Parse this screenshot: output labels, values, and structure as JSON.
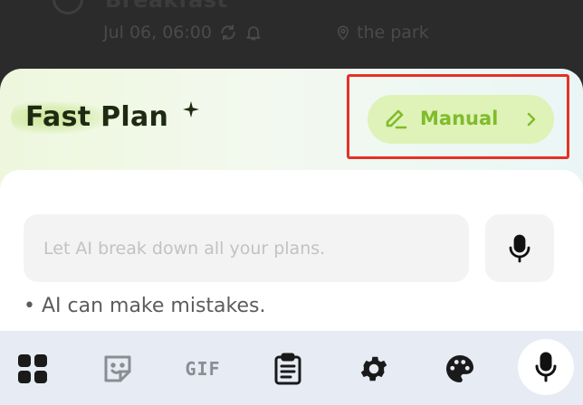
{
  "background_item": {
    "title": "Breakfast",
    "datetime": "Jul 06, 06:00",
    "location": "the park"
  },
  "sheet": {
    "title": "Fast Plan",
    "manual_button_label": "Manual",
    "input_placeholder": "Let AI break down all your plans.",
    "disclaimer": "• AI can make mistakes."
  },
  "keyboard_toolbar": {
    "items": [
      "apps-grid-icon",
      "sticker-icon",
      "gif-icon",
      "clipboard-icon",
      "gear-icon",
      "palette-icon",
      "microphone-icon"
    ],
    "gif_label": "GIF"
  },
  "colors": {
    "accent_green": "#7fbc2a",
    "manual_button_bg": "#dff2b8",
    "highlight_red": "#e53126",
    "title_dark": "#1f2a12"
  }
}
